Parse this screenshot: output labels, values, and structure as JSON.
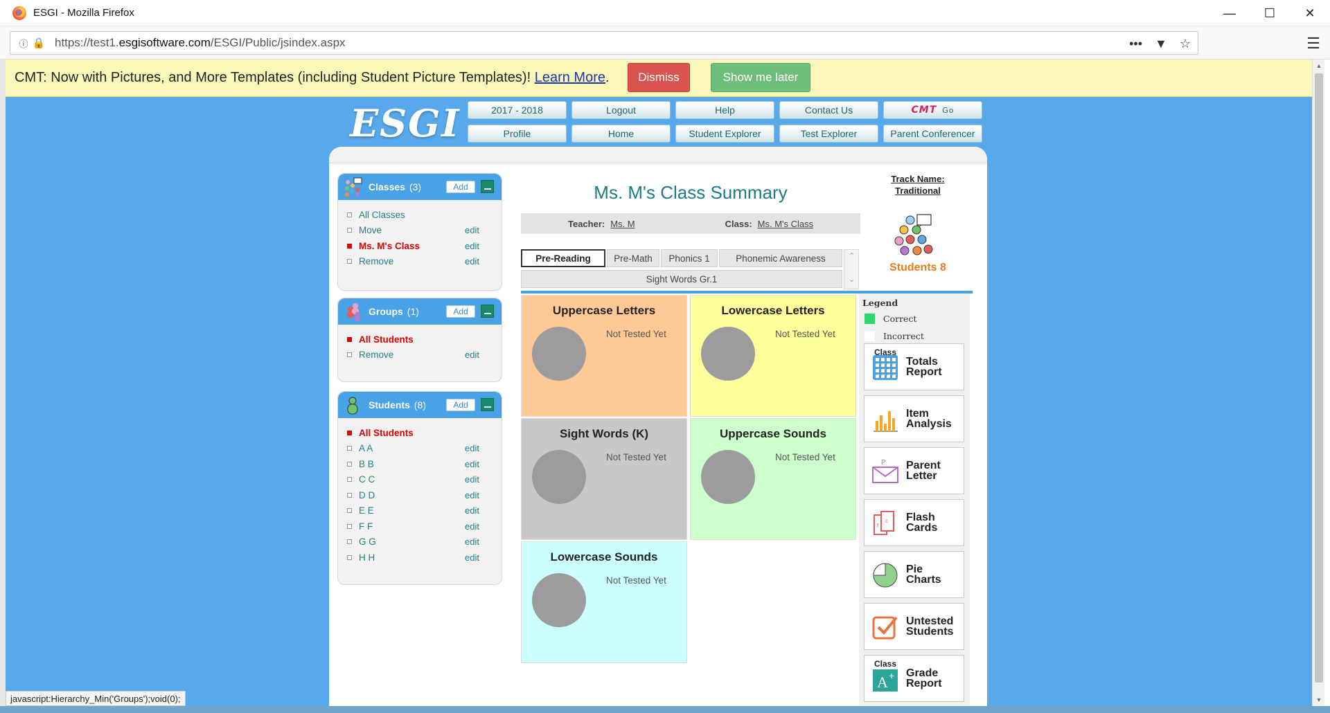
{
  "browser": {
    "window_title": "ESGI - Mozilla Firefox",
    "url_prefix": "https://test1.",
    "url_domain": "esgisoftware.com",
    "url_path": "/ESGI/Public/jsindex.aspx",
    "more_icon": "•••"
  },
  "notification": {
    "text": "CMT: Now with Pictures, and More Templates (including Student Picture Templates)! ",
    "link": "Learn More",
    "period": ".",
    "dismiss": "Dismiss",
    "later": "Show me later"
  },
  "header": {
    "logo": "ESGI",
    "row1": [
      "2017 - 2018",
      "Logout",
      "Help",
      "Contact Us"
    ],
    "cmt_text": "CMT",
    "cmt_go": "Go",
    "row2": [
      "Profile",
      "Home",
      "Student Explorer",
      "Test Explorer",
      "Parent Conferencer"
    ]
  },
  "sidebar": {
    "add_label": "Add",
    "edit_label": "edit",
    "classes": {
      "title": "Classes",
      "count": "(3)",
      "items": [
        {
          "label": "All Classes",
          "active": false,
          "edit": false
        },
        {
          "label": "Move",
          "active": false,
          "edit": true
        },
        {
          "label": "Ms. M's Class",
          "active": true,
          "edit": true
        },
        {
          "label": "Remove",
          "active": false,
          "edit": true
        }
      ]
    },
    "groups": {
      "title": "Groups",
      "count": "(1)",
      "items": [
        {
          "label": "All Students",
          "active": true,
          "edit": false
        },
        {
          "label": "Remove",
          "active": false,
          "edit": true
        }
      ]
    },
    "students": {
      "title": "Students",
      "count": "(8)",
      "items": [
        {
          "label": "All Students",
          "active": true,
          "edit": false
        },
        {
          "label": "A A",
          "active": false,
          "edit": true
        },
        {
          "label": "B B",
          "active": false,
          "edit": true
        },
        {
          "label": "C C",
          "active": false,
          "edit": true
        },
        {
          "label": "D D",
          "active": false,
          "edit": true
        },
        {
          "label": "E E",
          "active": false,
          "edit": true
        },
        {
          "label": "F F",
          "active": false,
          "edit": true
        },
        {
          "label": "G G",
          "active": false,
          "edit": true
        },
        {
          "label": "H H",
          "active": false,
          "edit": true
        }
      ]
    }
  },
  "summary": {
    "title": "Ms. M's Class Summary",
    "track_label": "Track Name:",
    "track_name": "Traditional",
    "students_label": "Students 8",
    "teacher_label": "Teacher:",
    "teacher_value": "Ms. M",
    "class_label": "Class:",
    "class_value": "Ms. M's Class",
    "tabs": [
      "Pre-Reading",
      "Pre-Math",
      "Phonics 1",
      "Phonemic Awareness",
      "Sight Words Gr.1"
    ],
    "active_tab": "Pre-Reading",
    "tiles": [
      {
        "name": "Uppercase Letters",
        "status": "Not Tested Yet",
        "color": "#ffc997"
      },
      {
        "name": "Lowercase Letters",
        "status": "Not Tested Yet",
        "color": "#ffff9c"
      },
      {
        "name": "Sight Words (K)",
        "status": "Not Tested Yet",
        "color": "#c8c8c8"
      },
      {
        "name": "Uppercase Sounds",
        "status": "Not Tested Yet",
        "color": "#ccffcc"
      },
      {
        "name": "Lowercase Sounds",
        "status": "Not Tested Yet",
        "color": "#ccffff"
      }
    ]
  },
  "legend": {
    "title": "Legend",
    "correct": "Correct",
    "incorrect": "Incorrect",
    "correct_color": "#2fd76b",
    "incorrect_color": "#ffffff"
  },
  "reports": [
    {
      "small": "Class",
      "line1": "Totals",
      "line2": "Report",
      "icon": "calculator-icon"
    },
    {
      "small": "",
      "line1": "Item",
      "line2": "Analysis",
      "icon": "bar-chart-icon"
    },
    {
      "small": "",
      "line1": "Parent",
      "line2": "Letter",
      "icon": "envelope-icon"
    },
    {
      "small": "",
      "line1": "Flash",
      "line2": "Cards",
      "icon": "flash-cards-icon"
    },
    {
      "small": "",
      "line1": "Pie",
      "line2": "Charts",
      "icon": "pie-chart-icon"
    },
    {
      "small": "",
      "line1": "Untested",
      "line2": "Students",
      "icon": "checkbox-icon"
    },
    {
      "small": "Class",
      "line1": "Grade",
      "line2": "Report",
      "icon": "grade-icon"
    }
  ],
  "status_bar": "javascript:Hierarchy_Min('Groups');void(0);",
  "colors": {
    "page_bg": "#57a9eb",
    "accent": "#4aa2e6",
    "active_red": "#e00000",
    "teal_text": "#1f7e8a"
  }
}
